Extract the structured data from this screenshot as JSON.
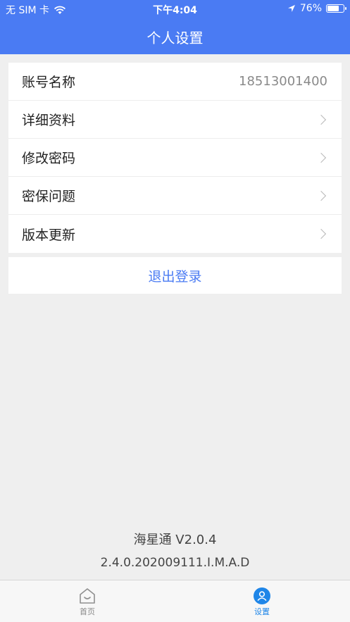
{
  "status_bar": {
    "carrier": "无 SIM 卡",
    "time": "下午4:04",
    "battery_percent": "76%",
    "battery_level": 0.76
  },
  "header": {
    "title": "个人设置"
  },
  "settings": {
    "rows": [
      {
        "label": "账号名称",
        "value": "18513001400"
      },
      {
        "label": "详细资料"
      },
      {
        "label": "修改密码"
      },
      {
        "label": "密保问题"
      },
      {
        "label": "版本更新"
      }
    ]
  },
  "logout": {
    "label": "退出登录"
  },
  "footer": {
    "app_name": "海星通 V2.0.4",
    "build": "2.4.0.202009111.I.M.A.D"
  },
  "tabbar": {
    "tabs": [
      {
        "label": "首页",
        "icon": "home-icon",
        "active": false
      },
      {
        "label": "设置",
        "icon": "user-icon",
        "active": true
      }
    ]
  },
  "colors": {
    "accent": "#4a7bf3",
    "tab_active": "#1f86e8",
    "background": "#efefef"
  }
}
